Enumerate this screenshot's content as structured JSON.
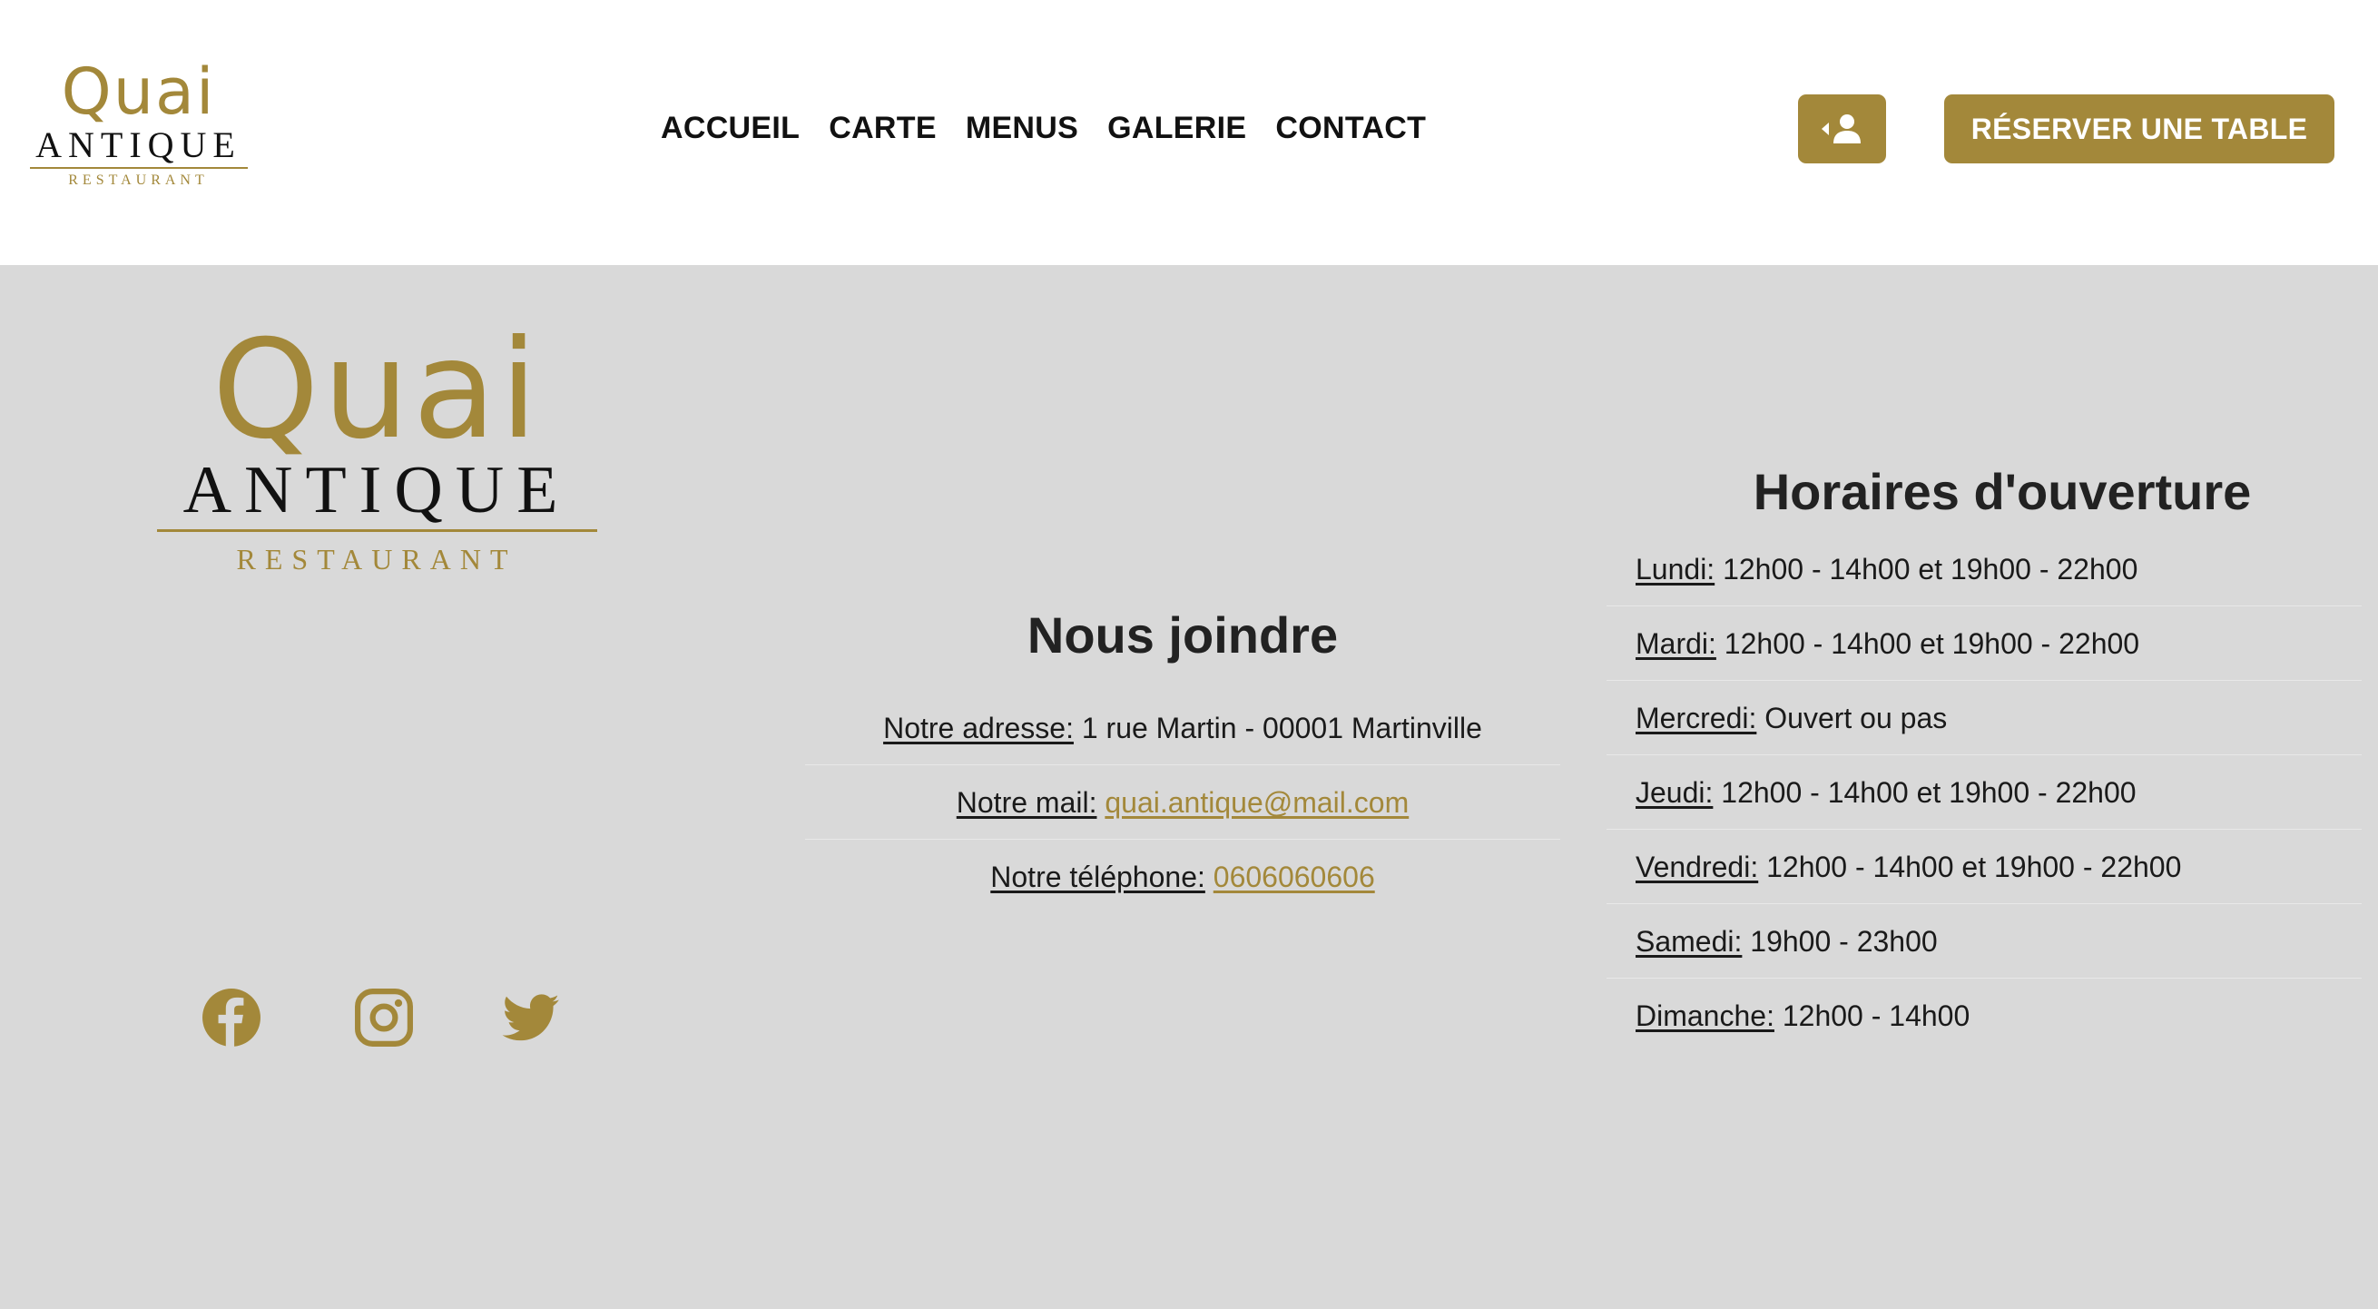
{
  "brand": {
    "quai": "Quai",
    "antique": "ANTIQUE",
    "restaurant": "RESTAURANT",
    "gold": "#a3883a",
    "footer_bg": "#d9d9d9"
  },
  "nav": {
    "items": [
      "ACCUEIL",
      "CARTE",
      "MENUS",
      "GALERIE",
      "CONTACT"
    ]
  },
  "header": {
    "account_icon": "user-login-icon",
    "reserve_label": "RÉSERVER UNE TABLE"
  },
  "contact": {
    "title": "Nous joindre",
    "address_label": "Notre adresse:",
    "address_value": "1 rue Martin - 00001 Martinville",
    "mail_label": "Notre mail:",
    "mail_value": "quai.antique@mail.com",
    "phone_label": "Notre téléphone:",
    "phone_value": "0606060606"
  },
  "hours": {
    "title": "Horaires d'ouverture",
    "days": [
      {
        "day": "Lundi:",
        "value": "12h00 - 14h00 et 19h00 - 22h00"
      },
      {
        "day": "Mardi:",
        "value": "12h00 - 14h00 et 19h00 - 22h00"
      },
      {
        "day": "Mercredi:",
        "value": "Ouvert ou pas"
      },
      {
        "day": "Jeudi:",
        "value": "12h00 - 14h00 et 19h00 - 22h00"
      },
      {
        "day": "Vendredi:",
        "value": "12h00 - 14h00 et 19h00 - 22h00"
      },
      {
        "day": "Samedi:",
        "value": "19h00 - 23h00"
      },
      {
        "day": "Dimanche:",
        "value": "12h00 - 14h00"
      }
    ]
  },
  "socials": [
    "facebook-icon",
    "instagram-icon",
    "twitter-icon"
  ]
}
